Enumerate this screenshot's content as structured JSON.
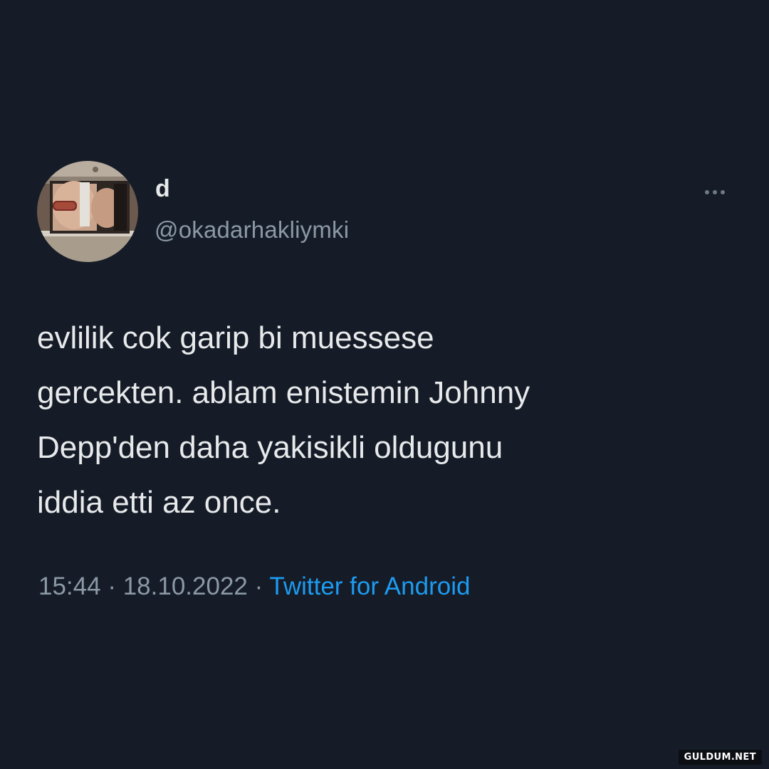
{
  "tweet": {
    "author": {
      "display_name": "d",
      "handle": "@okadarhakliymki"
    },
    "text_lines": [
      "evlilik cok garip bi muessese",
      "gercekten. ablam enistemin Johnny",
      "Depp'den daha yakisikli oldugunu",
      "iddia etti az once."
    ],
    "time": "15:44",
    "separator": "·",
    "date": "18.10.2022",
    "source": "Twitter for Android"
  },
  "more_icon": "more-horizontal-icon",
  "watermark": "GULDUM.NET",
  "colors": {
    "background": "#151c28",
    "text": "#e7e9ea",
    "secondary": "#8b98a5",
    "link": "#1d9bf0"
  }
}
